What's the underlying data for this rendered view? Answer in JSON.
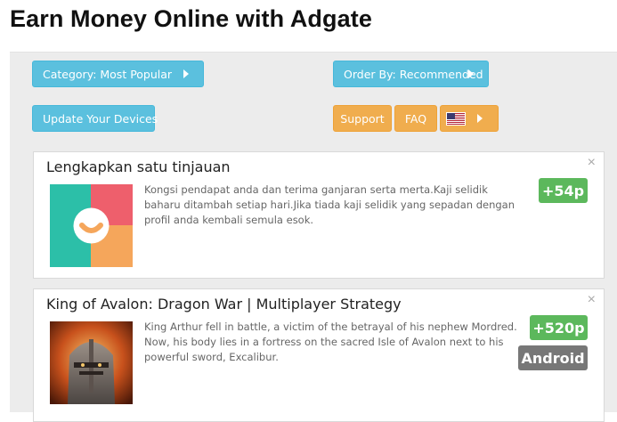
{
  "page": {
    "title": "Earn Money Online with Adgate"
  },
  "toolbar": {
    "category_label": "Category: Most Popular",
    "order_label": "Order By: Recommended",
    "update_devices_label": "Update Your Devices",
    "support_label": "Support",
    "faq_label": "FAQ",
    "country_flag": "us-flag-icon"
  },
  "colors": {
    "info_blue": "#5bc0de",
    "warning_orange": "#f0ad4e",
    "points_green": "#5cb85c",
    "platform_gray": "#777777"
  },
  "offers": [
    {
      "title": "Lengkapkan satu tinjauan",
      "description": "Kongsi pendapat anda dan terima ganjaran serta merta.Kaji selidik baharu ditambah setiap hari.Jika tiada kaji selidik yang sepadan dengan profil anda kembali semula esok.",
      "points": "+54p",
      "icon": "survey-app-icon"
    },
    {
      "title": "King of Avalon: Dragon War | Multiplayer Strategy",
      "description": "King Arthur fell in battle, a victim of the betrayal of his nephew Mordred. Now, his body lies in a fortress on the sacred Isle of Avalon next to his powerful sword, Excalibur.",
      "points": "+520p",
      "platform": "Android",
      "icon": "knight-game-icon"
    }
  ],
  "close_symbol": "×"
}
